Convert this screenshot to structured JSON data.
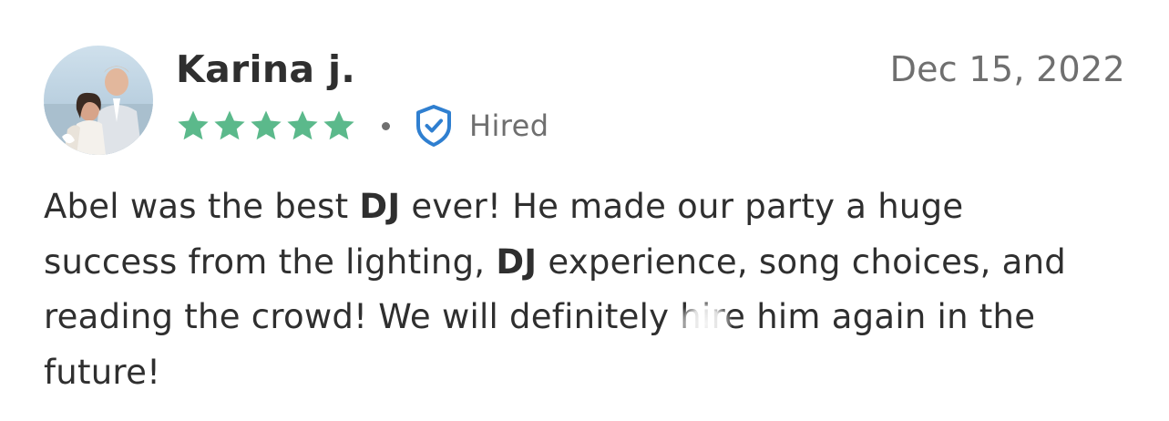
{
  "review": {
    "reviewer_name": "Karina j.",
    "date": "Dec 15, 2022",
    "rating": 5,
    "rating_max": 5,
    "separator": "•",
    "hired_label": "Hired",
    "icons": {
      "avatar": "reviewer-avatar",
      "star": "star-icon",
      "hired": "shield-check-icon"
    },
    "colors": {
      "star": "#5bb98b",
      "shield": "#2f7fd0",
      "text": "#2f2f2f",
      "muted": "#6f6f6f"
    },
    "body_lines": [
      [
        "Abel was the best ",
        "DJ",
        " ever! He made our party a huge"
      ],
      [
        "success from the lighting, ",
        "DJ",
        " experience, song choices, and"
      ],
      [
        "reading the crowd! We will definitely hire him again in the"
      ],
      [
        "future!"
      ]
    ]
  }
}
